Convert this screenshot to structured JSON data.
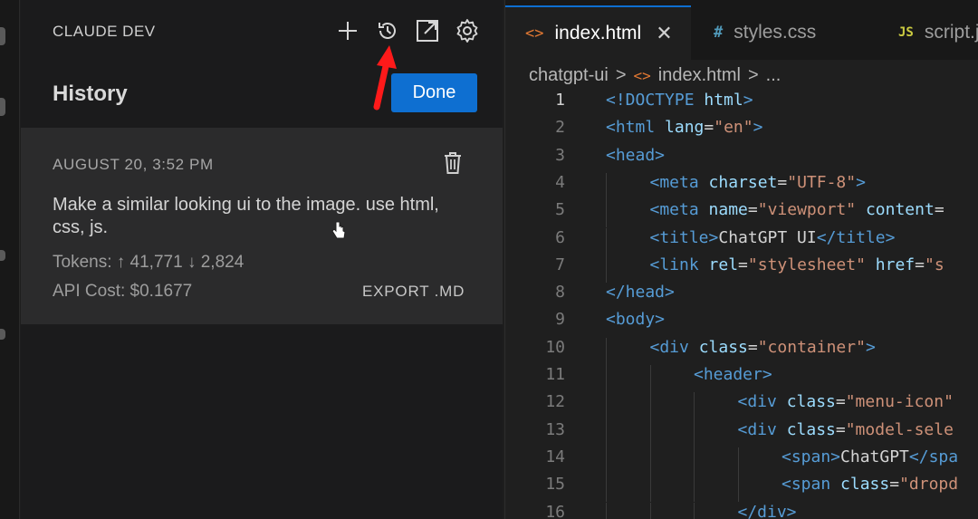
{
  "sidebar": {
    "title": "CLAUDE DEV",
    "header_icons": [
      "plus-icon",
      "history-icon",
      "external-link-icon",
      "gear-icon"
    ],
    "history_title": "History",
    "done_label": "Done",
    "item": {
      "date": "AUGUST 20, 3:52 PM",
      "task": "Make a similar looking ui to the image. use html, css, js.",
      "tokens_label": "Tokens:",
      "tokens_in": "↑ 41,771",
      "tokens_out": "↓ 2,824",
      "cost_label": "API Cost:",
      "cost_value": "$0.1677",
      "export_label": "EXPORT .MD"
    }
  },
  "editor": {
    "tabs": [
      {
        "icon": "<>",
        "label": "index.html",
        "active": true
      },
      {
        "icon": "#",
        "label": "styles.css",
        "active": false
      },
      {
        "icon": "JS",
        "label": "script.js",
        "active": false
      }
    ],
    "breadcrumb": [
      "chatgpt-ui",
      ">",
      "<>",
      "index.html",
      ">",
      "..."
    ],
    "current_line": 1,
    "lines": [
      {
        "n": "1",
        "indent": 0,
        "code": [
          [
            "t",
            "<!DOCTYPE "
          ],
          [
            "a",
            "html"
          ],
          [
            "t",
            ">"
          ]
        ]
      },
      {
        "n": "2",
        "indent": 0,
        "code": [
          [
            "t",
            "<html "
          ],
          [
            "a",
            "lang"
          ],
          [
            "x",
            "="
          ],
          [
            "s",
            "\"en\""
          ],
          [
            "t",
            ">"
          ]
        ]
      },
      {
        "n": "3",
        "indent": 0,
        "code": [
          [
            "t",
            "<head>"
          ]
        ]
      },
      {
        "n": "4",
        "indent": 1,
        "code": [
          [
            "t",
            "<meta "
          ],
          [
            "a",
            "charset"
          ],
          [
            "x",
            "="
          ],
          [
            "s",
            "\"UTF-8\""
          ],
          [
            "t",
            ">"
          ]
        ]
      },
      {
        "n": "5",
        "indent": 1,
        "code": [
          [
            "t",
            "<meta "
          ],
          [
            "a",
            "name"
          ],
          [
            "x",
            "="
          ],
          [
            "s",
            "\"viewport\""
          ],
          [
            "x",
            " "
          ],
          [
            "a",
            "content"
          ],
          [
            "x",
            "="
          ]
        ]
      },
      {
        "n": "6",
        "indent": 1,
        "code": [
          [
            "t",
            "<title>"
          ],
          [
            "x",
            "ChatGPT UI"
          ],
          [
            "t",
            "</title>"
          ]
        ]
      },
      {
        "n": "7",
        "indent": 1,
        "code": [
          [
            "t",
            "<link "
          ],
          [
            "a",
            "rel"
          ],
          [
            "x",
            "="
          ],
          [
            "s",
            "\"stylesheet\""
          ],
          [
            "x",
            " "
          ],
          [
            "a",
            "href"
          ],
          [
            "x",
            "="
          ],
          [
            "s",
            "\"s"
          ]
        ]
      },
      {
        "n": "8",
        "indent": 0,
        "code": [
          [
            "t",
            "</head>"
          ]
        ]
      },
      {
        "n": "9",
        "indent": 0,
        "code": [
          [
            "t",
            "<body>"
          ]
        ]
      },
      {
        "n": "10",
        "indent": 1,
        "code": [
          [
            "t",
            "<div "
          ],
          [
            "a",
            "class"
          ],
          [
            "x",
            "="
          ],
          [
            "s",
            "\"container\""
          ],
          [
            "t",
            ">"
          ]
        ]
      },
      {
        "n": "11",
        "indent": 2,
        "code": [
          [
            "t",
            "<header>"
          ]
        ]
      },
      {
        "n": "12",
        "indent": 3,
        "code": [
          [
            "t",
            "<div "
          ],
          [
            "a",
            "class"
          ],
          [
            "x",
            "="
          ],
          [
            "s",
            "\"menu-icon\""
          ]
        ]
      },
      {
        "n": "13",
        "indent": 3,
        "code": [
          [
            "t",
            "<div "
          ],
          [
            "a",
            "class"
          ],
          [
            "x",
            "="
          ],
          [
            "s",
            "\"model-sele"
          ]
        ]
      },
      {
        "n": "14",
        "indent": 4,
        "code": [
          [
            "t",
            "<span>"
          ],
          [
            "x",
            "ChatGPT"
          ],
          [
            "t",
            "</spa"
          ]
        ]
      },
      {
        "n": "15",
        "indent": 4,
        "code": [
          [
            "t",
            "<span "
          ],
          [
            "a",
            "class"
          ],
          [
            "x",
            "="
          ],
          [
            "s",
            "\"dropd"
          ]
        ]
      },
      {
        "n": "16",
        "indent": 3,
        "code": [
          [
            "t",
            "</div>"
          ]
        ]
      }
    ]
  }
}
